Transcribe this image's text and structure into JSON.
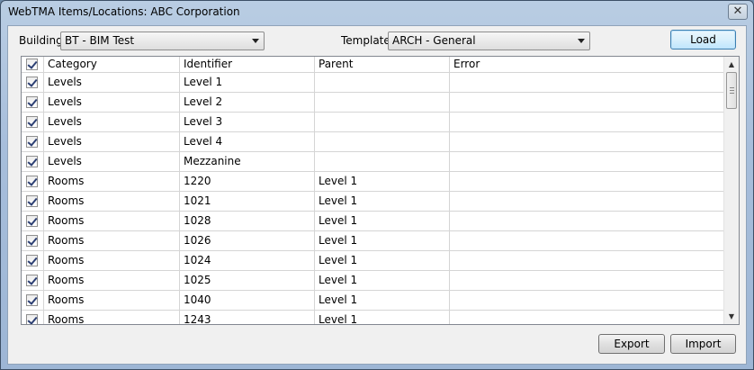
{
  "window": {
    "title": "WebTMA Items/Locations: ABC Corporation",
    "close_glyph": "✕"
  },
  "building": {
    "label": "Building",
    "value": "BT - BIM Test"
  },
  "template": {
    "label": "Template",
    "value": "ARCH - General"
  },
  "buttons": {
    "load": "Load",
    "export": "Export",
    "import": "Import"
  },
  "grid": {
    "columns": [
      "Category",
      "Identifier",
      "Parent",
      "Error"
    ],
    "rows": [
      {
        "checked": true,
        "category": "Levels",
        "identifier": "Level 1",
        "parent": "",
        "error": ""
      },
      {
        "checked": true,
        "category": "Levels",
        "identifier": "Level 2",
        "parent": "",
        "error": ""
      },
      {
        "checked": true,
        "category": "Levels",
        "identifier": "Level 3",
        "parent": "",
        "error": ""
      },
      {
        "checked": true,
        "category": "Levels",
        "identifier": "Level 4",
        "parent": "",
        "error": ""
      },
      {
        "checked": true,
        "category": "Levels",
        "identifier": "Mezzanine",
        "parent": "",
        "error": ""
      },
      {
        "checked": true,
        "category": "Rooms",
        "identifier": "1220",
        "parent": "Level 1",
        "error": ""
      },
      {
        "checked": true,
        "category": "Rooms",
        "identifier": "1021",
        "parent": "Level 1",
        "error": ""
      },
      {
        "checked": true,
        "category": "Rooms",
        "identifier": "1028",
        "parent": "Level 1",
        "error": ""
      },
      {
        "checked": true,
        "category": "Rooms",
        "identifier": "1026",
        "parent": "Level 1",
        "error": ""
      },
      {
        "checked": true,
        "category": "Rooms",
        "identifier": "1024",
        "parent": "Level 1",
        "error": ""
      },
      {
        "checked": true,
        "category": "Rooms",
        "identifier": "1025",
        "parent": "Level 1",
        "error": ""
      },
      {
        "checked": true,
        "category": "Rooms",
        "identifier": "1040",
        "parent": "Level 1",
        "error": ""
      },
      {
        "checked": true,
        "category": "Rooms",
        "identifier": "1243",
        "parent": "Level 1",
        "error": ""
      }
    ]
  }
}
